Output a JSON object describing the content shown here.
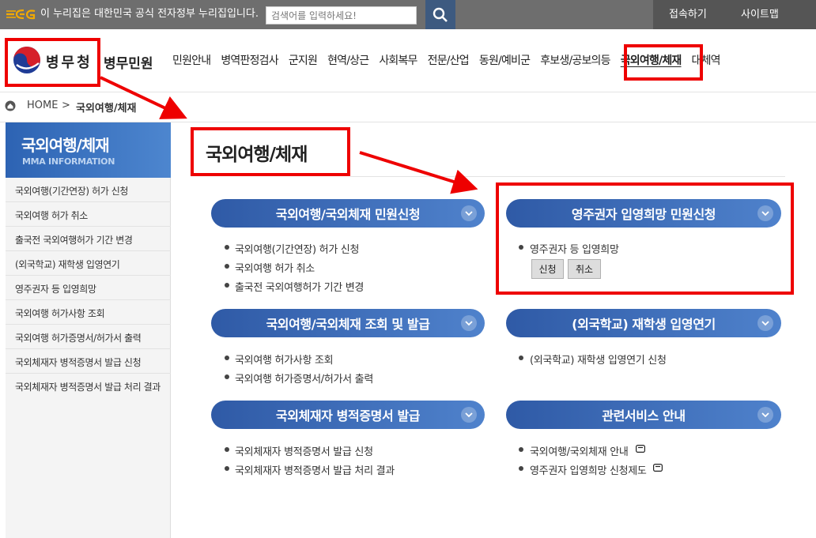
{
  "topbar": {
    "logo_icon": "eg-logo-icon",
    "gov_notice": "이 누리집은 대한민국 공식 전자정부 누리집입니다.",
    "search": {
      "placeholder": "검색어를 입력하세요!",
      "value": ""
    },
    "search_icon": "search-icon",
    "links": [
      "접속하기",
      "사이트맵"
    ]
  },
  "header": {
    "logo_text": "병무청",
    "service_name": "병무민원",
    "nav": [
      "민원안내",
      "병역판정검사",
      "군지원",
      "현역/상근",
      "사회복무",
      "전문/산업",
      "동원/예비군",
      "후보생/공보의등",
      "국외여행/체재",
      "대체역"
    ],
    "active_nav": "국외여행/체재"
  },
  "breadcrumb": {
    "home": "HOME",
    "separator": ">",
    "current": "국외여행/체재"
  },
  "sidebar": {
    "title": "국외여행/체재",
    "subtitle": "MMA INFORMATION",
    "items": [
      "국외여행(기간연장) 허가 신청",
      "국외여행 허가 취소",
      "출국전 국외여행허가 기간 변경",
      "(외국학교) 재학생 입영연기",
      "영주권자 등 입영희망",
      "국외여행 허가사항 조회",
      "국외여행 허가증명서/허가서 출력",
      "국외체재자 병적증명서 발급 신청",
      "국외체재자 병적증명서 발급 처리 결과"
    ]
  },
  "main": {
    "title": "국외여행/체재",
    "sections": [
      {
        "label": "국외여행/국외체재 민원신청",
        "items": [
          "국외여행(기간연장) 허가 신청",
          "국외여행 허가 취소",
          "출국전 국외여행허가 기간 변경"
        ]
      },
      {
        "label": "영주권자 입영희망 민원신청",
        "items": [
          "영주권자 등 입영희망"
        ],
        "buttons": [
          "신청",
          "취소"
        ]
      },
      {
        "label": "국외여행/국외체재 조회 및 발급",
        "items": [
          "국외여행 허가사항 조회",
          "국외여행 허가증명서/허가서 출력"
        ]
      },
      {
        "label": "(외국학교) 재학생 입영연기",
        "items": [
          "(외국학교) 재학생 입영연기 신청"
        ]
      },
      {
        "label": "국외체재자 병적증명서 발급",
        "items": [
          "국외체재자 병적증명서 발급 신청",
          "국외체재자 병적증명서 발급 처리 결과"
        ]
      },
      {
        "label": "관련서비스 안내",
        "items": [
          "국외여행/국외체재 안내",
          "영주권자 입영희망 신청제도"
        ],
        "icon": "external-link-icon"
      }
    ]
  },
  "colors": {
    "highlight": "#ee0000",
    "pill": "#2f5aa6",
    "topbar": "#6e6e6e",
    "sidebar_header": "#2d63b3"
  }
}
